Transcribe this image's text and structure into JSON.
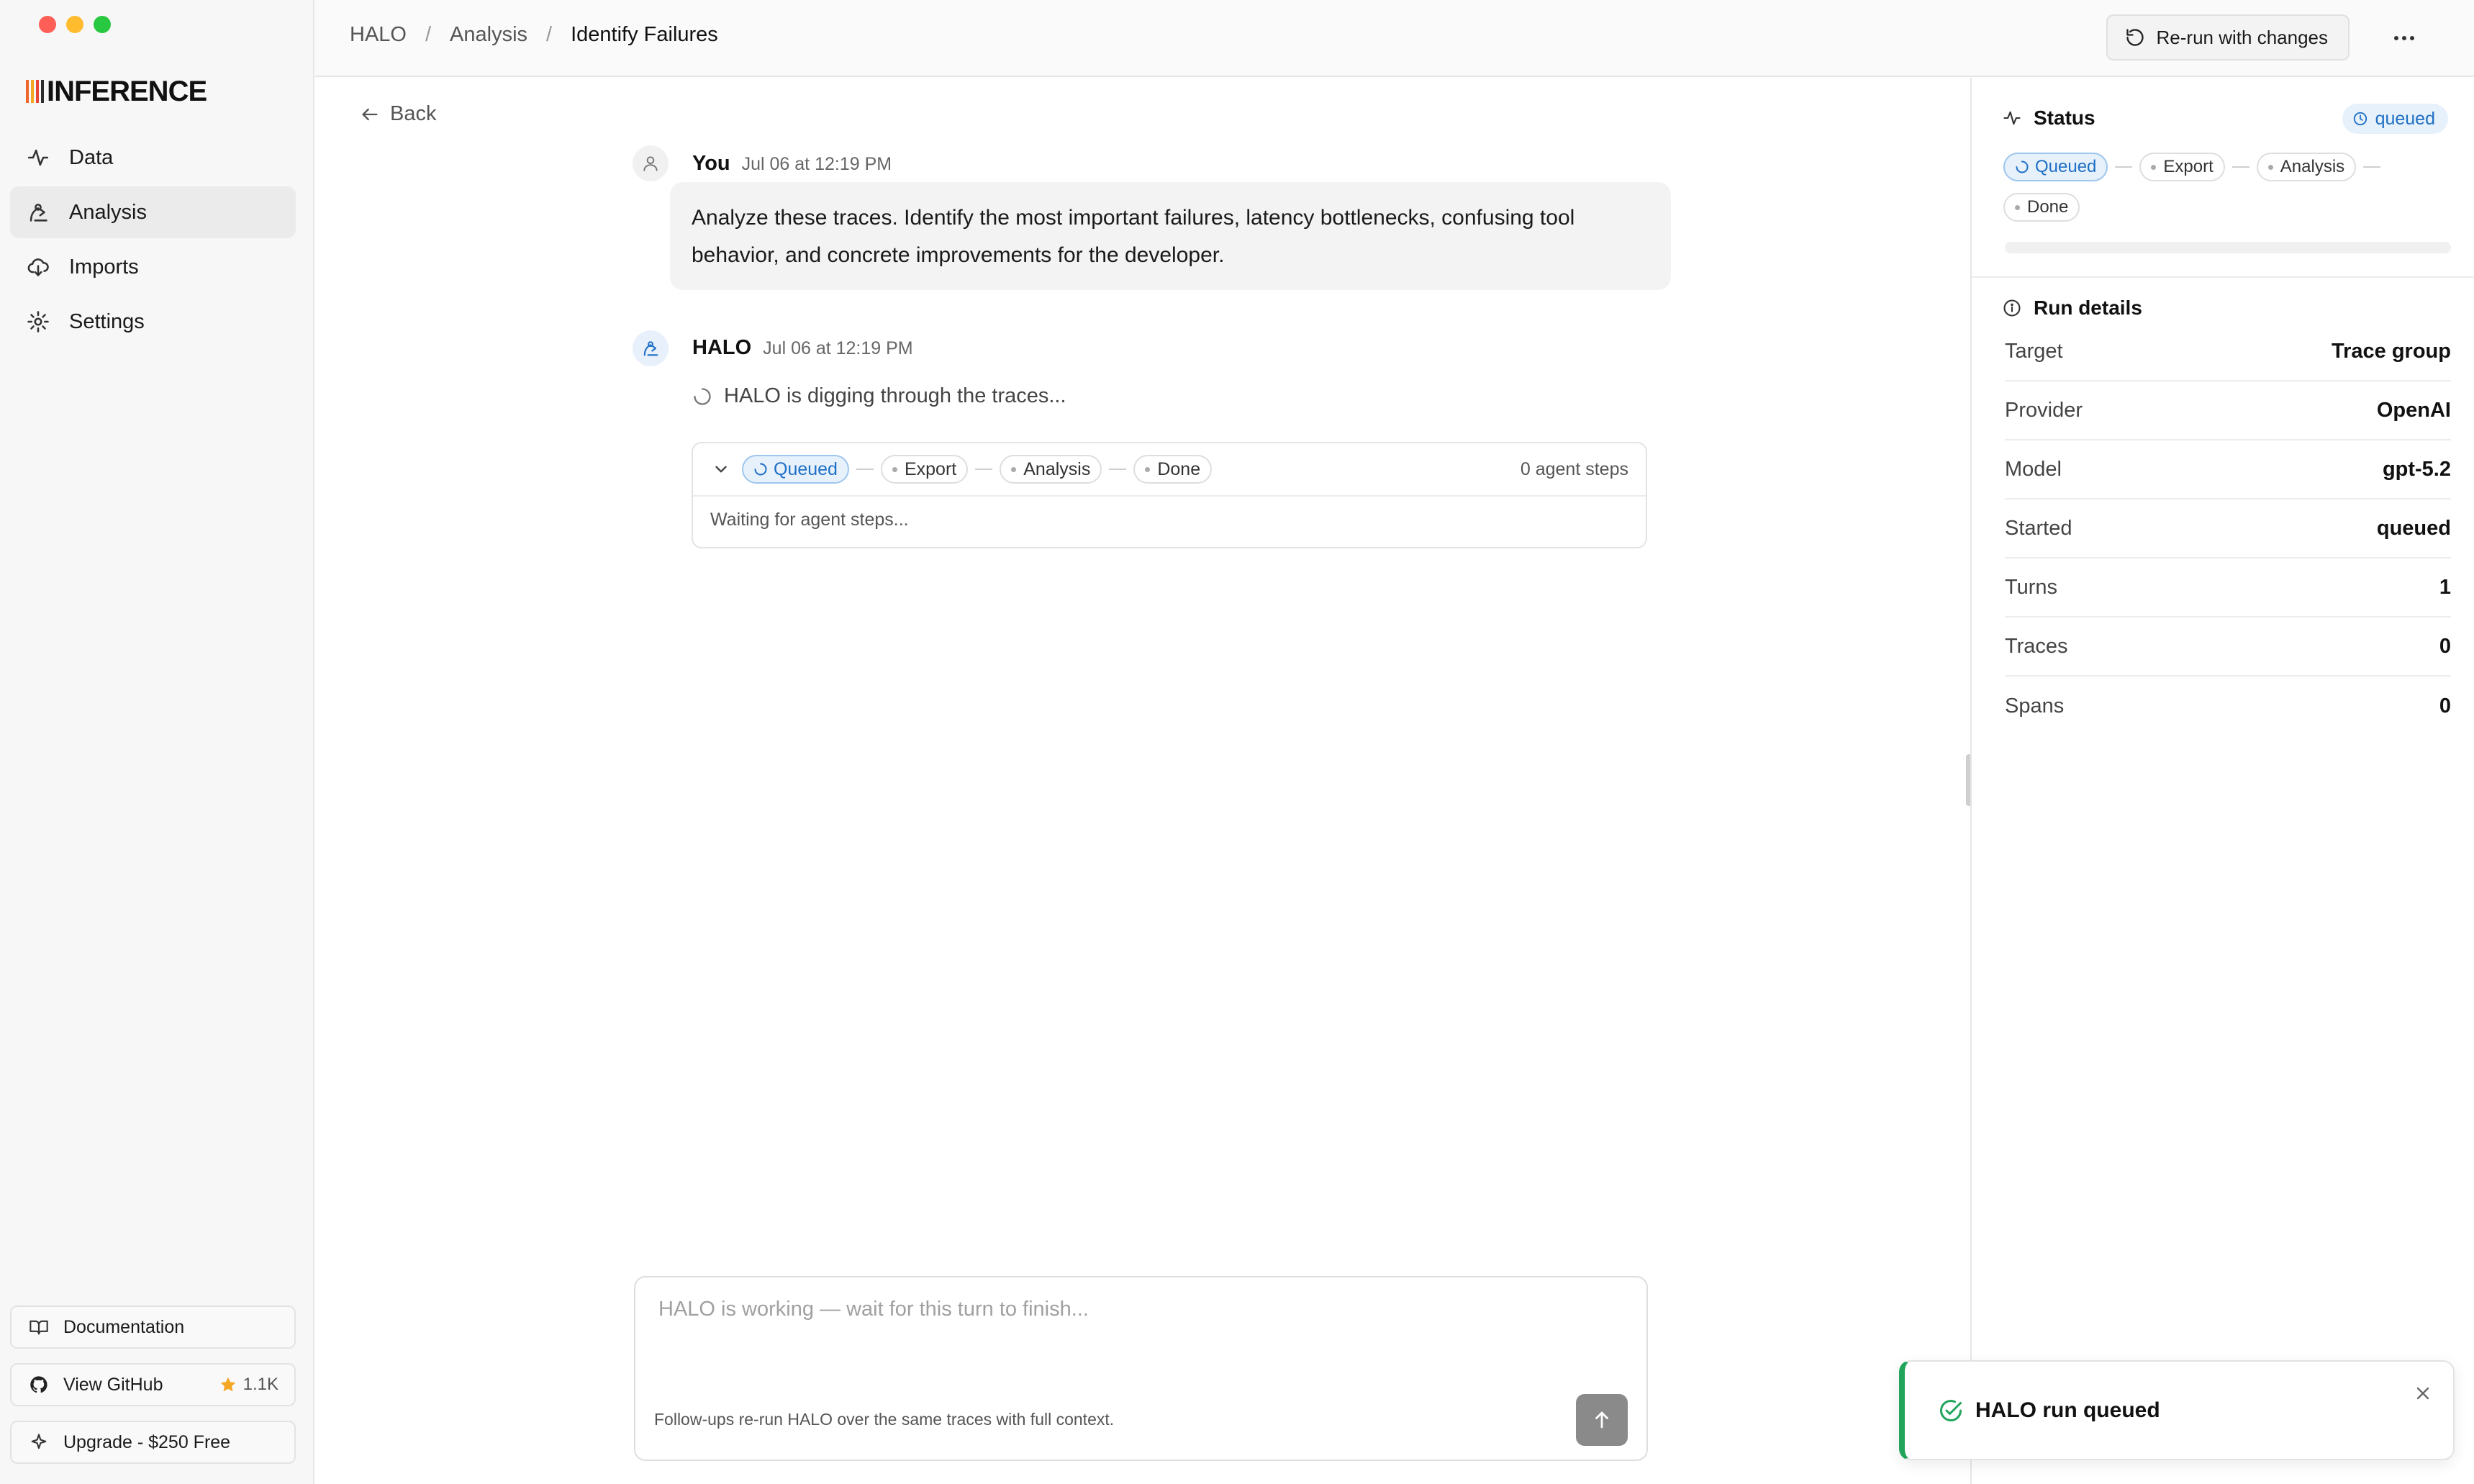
{
  "app": {
    "logo_text": "INFERENCE",
    "colors": {
      "accent": "#1f6fc5",
      "success": "#22a55b",
      "logo_bars": [
        "#f0642a",
        "#f5a623",
        "#e8443a",
        "#2d2d2d"
      ]
    }
  },
  "sidebar": {
    "items": [
      {
        "label": "Data",
        "icon": "activity-icon"
      },
      {
        "label": "Analysis",
        "icon": "analysis-icon",
        "active": true
      },
      {
        "label": "Imports",
        "icon": "cloud-download-icon"
      },
      {
        "label": "Settings",
        "icon": "gear-icon"
      }
    ],
    "footer": {
      "docs_label": "Documentation",
      "github_label": "View GitHub",
      "github_stars": "1.1K",
      "upgrade_label": "Upgrade - $250 Free"
    }
  },
  "header": {
    "breadcrumb": [
      "HALO",
      "Analysis",
      "Identify Failures"
    ],
    "rerun_label": "Re-run with changes"
  },
  "main": {
    "back_label": "Back",
    "user_message": {
      "author": "You",
      "time": "Jul 06 at 12:19 PM",
      "text": "Analyze these traces. Identify the most important failures, latency bottlenecks, confusing tool behavior, and concrete improvements for the developer."
    },
    "halo_message": {
      "author": "HALO",
      "time": "Jul 06 at 12:19 PM",
      "status_text": "HALO is digging through the traces..."
    },
    "run_card": {
      "steps": [
        "Queued",
        "Export",
        "Analysis",
        "Done"
      ],
      "active_step": "Queued",
      "agent_steps": "0 agent steps",
      "body_text": "Waiting for agent steps..."
    },
    "composer": {
      "placeholder": "HALO is working — wait for this turn to finish...",
      "value": "",
      "note": "Follow-ups re-run HALO over the same traces with full context."
    }
  },
  "right_panel": {
    "status_title": "Status",
    "status_badge": "queued",
    "steps": [
      "Queued",
      "Export",
      "Analysis",
      "Done"
    ],
    "progress": 0,
    "details_title": "Run details",
    "details": [
      {
        "label": "Target",
        "value": "Trace group"
      },
      {
        "label": "Provider",
        "value": "OpenAI"
      },
      {
        "label": "Model",
        "value": "gpt-5.2"
      },
      {
        "label": "Started",
        "value": "queued"
      },
      {
        "label": "Turns",
        "value": "1"
      },
      {
        "label": "Traces",
        "value": "0"
      },
      {
        "label": "Spans",
        "value": "0"
      }
    ]
  },
  "toast": {
    "text": "HALO run queued"
  }
}
